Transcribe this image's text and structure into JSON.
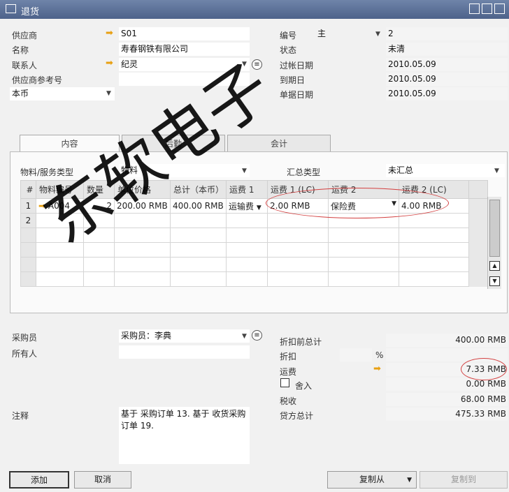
{
  "window": {
    "title": "退货"
  },
  "header_left": {
    "vendor_label": "供应商",
    "vendor_value": "S01",
    "name_label": "名称",
    "name_value": "寿春钢铁有限公司",
    "contact_label": "联系人",
    "contact_value": "纪灵",
    "vendor_ref_label": "供应商参考号",
    "vendor_ref_value": "",
    "currency_value": "本币"
  },
  "header_right": {
    "number_label": "编号",
    "series_value": "主",
    "number_value": "2",
    "status_label": "状态",
    "status_value": "未清",
    "posting_date_label": "过帐日期",
    "posting_date_value": "2010.05.09",
    "due_date_label": "到期日",
    "due_date_value": "2010.05.09",
    "doc_date_label": "单据日期",
    "doc_date_value": "2010.05.09"
  },
  "tabs": [
    {
      "label": "内容"
    },
    {
      "label": "后勤"
    },
    {
      "label": "会计"
    }
  ],
  "item_type": {
    "label": "物料/服务类型",
    "value": "物料"
  },
  "summary_type": {
    "label": "汇总类型",
    "value": "未汇总"
  },
  "grid": {
    "columns": [
      "#",
      "物料编号",
      "数量",
      "单位价格",
      "总计（本币）",
      "运费 1",
      "运费 1 (LC)",
      "运费 2",
      "运费 2 (LC)"
    ],
    "rows": [
      {
        "num": "1",
        "item": "A004",
        "qty": "2",
        "unit_price": "200.00 RMB",
        "total": "400.00 RMB",
        "freight1": "运输费",
        "freight1_lc": "2.00 RMB",
        "freight2": "保险费",
        "freight2_lc": "4.00 RMB"
      },
      {
        "num": "2",
        "item": "",
        "qty": "",
        "unit_price": "",
        "total": "",
        "freight1": "",
        "freight1_lc": "",
        "freight2": "",
        "freight2_lc": ""
      }
    ]
  },
  "footer_left": {
    "buyer_label": "采购员",
    "buyer_value": "采购员：李典",
    "owner_label": "所有人",
    "owner_value": "",
    "remarks_label": "注释",
    "remarks_value": "基于 采购订单 13. 基于 收货采购订单 19."
  },
  "totals": {
    "before_discount_label": "折扣前总计",
    "before_discount_value": "400.00 RMB",
    "discount_label": "折扣",
    "discount_pct_symbol": "%",
    "discount_value": "",
    "freight_label": "运费",
    "freight_value": "7.33 RMB",
    "rounding_label": "舍入",
    "rounding_value": "0.00 RMB",
    "tax_label": "税收",
    "tax_value": "68.00 RMB",
    "total_label": "贷方总计",
    "total_value": "475.33 RMB"
  },
  "buttons": {
    "add": "添加",
    "cancel": "取消",
    "copy_from": "复制从",
    "copy_to": "复制到"
  },
  "watermark": {
    "text": "东软电子"
  }
}
